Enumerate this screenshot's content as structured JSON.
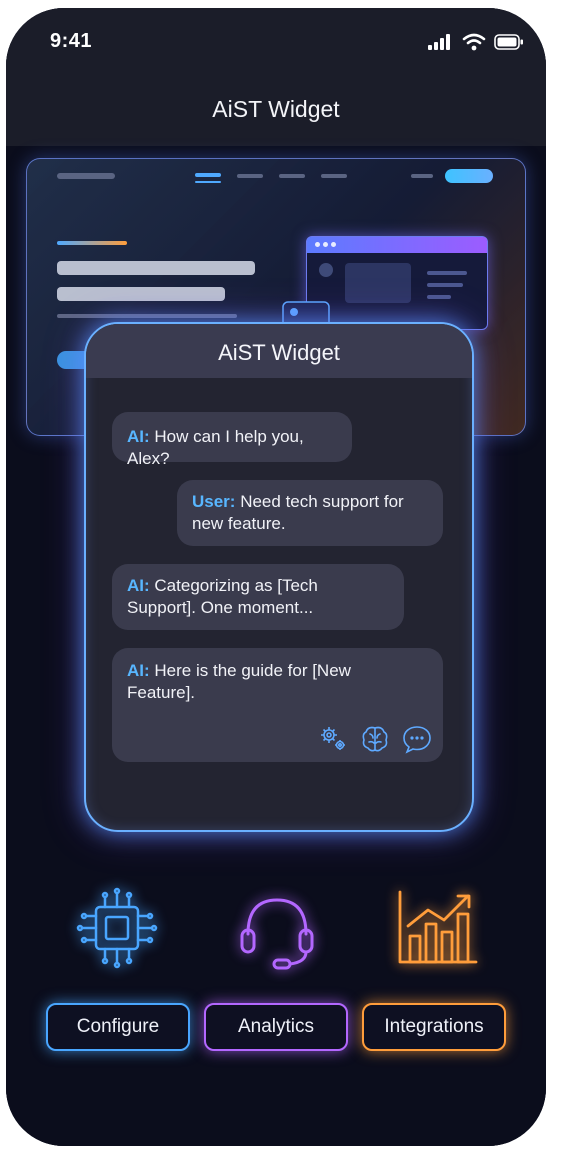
{
  "status": {
    "time": "9:41"
  },
  "app": {
    "title": "AiST Widget"
  },
  "widget": {
    "title": "AiST Widget",
    "messages": [
      {
        "speaker": "AI:",
        "text": "How can I help you, Alex?"
      },
      {
        "speaker": "User:",
        "text": "Need tech support for new feature."
      },
      {
        "speaker": "AI:",
        "text": "Categorizing as [Tech Support]. One moment..."
      },
      {
        "speaker": "AI:",
        "text": "Here is the guide for [New Feature]."
      }
    ],
    "message_icons": [
      "gears-icon",
      "brain-icon",
      "chat-bubble-icon"
    ]
  },
  "features": {
    "icons": [
      "cpu-chip-icon",
      "headset-icon",
      "bar-chart-icon"
    ],
    "buttons": [
      {
        "label": "Configure",
        "color": "#49a6ff"
      },
      {
        "label": "Analytics",
        "color": "#b367ff"
      },
      {
        "label": "Integrations",
        "color": "#ff9d3b"
      }
    ]
  },
  "colors": {
    "accent_blue": "#49a6ff",
    "accent_purple": "#b367ff",
    "accent_orange": "#ff9d3b",
    "speaker_label": "#58b6ff"
  }
}
